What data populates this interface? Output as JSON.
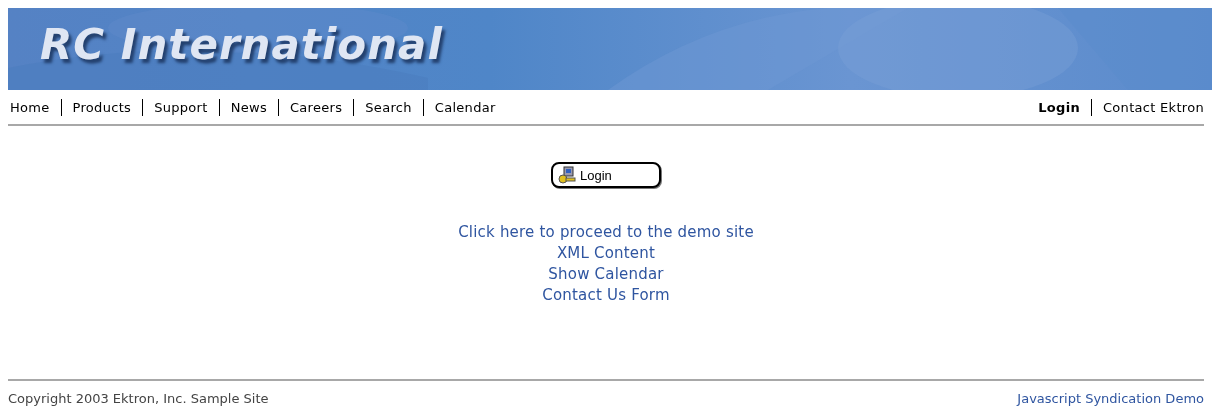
{
  "banner": {
    "logo": "RC International"
  },
  "nav_left": [
    {
      "label": "Home",
      "selected": false
    },
    {
      "label": "Products",
      "selected": false
    },
    {
      "label": "Support",
      "selected": false
    },
    {
      "label": "News",
      "selected": false
    },
    {
      "label": "Careers",
      "selected": false
    },
    {
      "label": "Search",
      "selected": false
    },
    {
      "label": "Calendar",
      "selected": false
    }
  ],
  "nav_right": [
    {
      "label": "Login",
      "selected": true
    },
    {
      "label": "Contact Ektron",
      "selected": false
    }
  ],
  "login_button": {
    "label": "Login"
  },
  "links": [
    "Click here to proceed to the demo site",
    "XML Content",
    "Show Calendar",
    "Contact Us Form"
  ],
  "footer": {
    "copyright": "Copyright 2003 Ektron, Inc. Sample Site",
    "link": "Javascript Syndication Demo"
  }
}
